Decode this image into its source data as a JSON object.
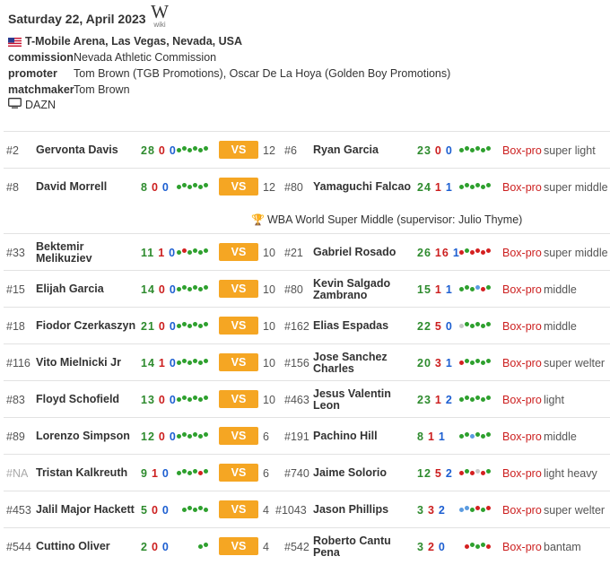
{
  "event": {
    "date": "Saturday 22, April 2023",
    "wiki_label": "wiki",
    "wiki_glyph": "W",
    "venue": "T-Mobile Arena, Las Vegas, Nevada, USA",
    "commission_label": "commission",
    "commission": "Nevada Athletic Commission",
    "promoter_label": "promoter",
    "promoter": "Tom Brown (TGB Promotions), Oscar De La Hoya (Golden Boy Promotions)",
    "matchmaker_label": "matchmaker",
    "matchmaker": "Tom Brown",
    "tv": "DAZN"
  },
  "vs_label": "VS",
  "boxpro_label": "Box-pro",
  "title_note": "WBA World Super Middle (supervisor: Julio Thyme)",
  "bouts": [
    {
      "r1": "#2",
      "n1": "Gervonta Davis",
      "w1": "28",
      "l1": "0",
      "d1": "0",
      "f1": "gggggg",
      "rounds": "12",
      "r2": "#6",
      "n2": "Ryan Garcia",
      "w2": "23",
      "l2": "0",
      "d2": "0",
      "f2": "gggggg",
      "division": "super light"
    },
    {
      "r1": "#8",
      "n1": "David Morrell",
      "w1": "8",
      "l1": "0",
      "d1": "0",
      "f1": "gggggg",
      "rounds": "12",
      "r2": "#80",
      "n2": "Yamaguchi Falcao",
      "w2": "24",
      "l2": "1",
      "d2": "1",
      "f2": "gggggg",
      "division": "super middle"
    },
    {
      "r1": "#33",
      "n1": "Bektemir Melikuziev",
      "w1": "11",
      "l1": "1",
      "d1": "0",
      "f1": "grgggg",
      "rounds": "10",
      "r2": "#21",
      "n2": "Gabriel Rosado",
      "w2": "26",
      "l2": "16",
      "d2": "1",
      "f2": "rgrrrr",
      "division": "super middle"
    },
    {
      "r1": "#15",
      "n1": "Elijah Garcia",
      "w1": "14",
      "l1": "0",
      "d1": "0",
      "f1": "gggggg",
      "rounds": "10",
      "r2": "#80",
      "n2": "Kevin Salgado Zambrano",
      "w2": "15",
      "l2": "1",
      "d2": "1",
      "f2": "gggbrg",
      "division": "middle"
    },
    {
      "r1": "#18",
      "n1": "Fiodor Czerkaszyn",
      "w1": "21",
      "l1": "0",
      "d1": "0",
      "f1": "gggggg",
      "rounds": "10",
      "r2": "#162",
      "n2": "Elias Espadas",
      "w2": "22",
      "l2": "5",
      "d2": "0",
      "f2": "xggggg",
      "division": "middle"
    },
    {
      "r1": "#116",
      "n1": "Vito Mielnicki Jr",
      "w1": "14",
      "l1": "1",
      "d1": "0",
      "f1": "gggggg",
      "rounds": "10",
      "r2": "#156",
      "n2": "Jose Sanchez Charles",
      "w2": "20",
      "l2": "3",
      "d2": "1",
      "f2": "rggggg",
      "division": "super welter"
    },
    {
      "r1": "#83",
      "n1": "Floyd Schofield",
      "w1": "13",
      "l1": "0",
      "d1": "0",
      "f1": "gggggg",
      "rounds": "10",
      "r2": "#463",
      "n2": "Jesus Valentin Leon",
      "w2": "23",
      "l2": "1",
      "d2": "2",
      "f2": "gggggg",
      "division": "light"
    },
    {
      "r1": "#89",
      "n1": "Lorenzo Simpson",
      "w1": "12",
      "l1": "0",
      "d1": "0",
      "f1": "gggggg",
      "rounds": "6",
      "r2": "#191",
      "n2": "Pachino Hill",
      "w2": "8",
      "l2": "1",
      "d2": "1",
      "f2": "ggbggg",
      "division": "middle"
    },
    {
      "r1": "#NA",
      "n1": "Tristan Kalkreuth",
      "w1": "9",
      "l1": "1",
      "d1": "0",
      "f1": "ggggrg",
      "rounds": "6",
      "r2": "#740",
      "n2": "Jaime Solorio",
      "w2": "12",
      "l2": "5",
      "d2": "2",
      "f2": "rgrxrg",
      "division": "light heavy"
    },
    {
      "r1": "#453",
      "n1": "Jalil Major Hackett",
      "w1": "5",
      "l1": "0",
      "d1": "0",
      "f1": "ggggg",
      "rounds": "4",
      "r2": "#1043",
      "n2": "Jason Phillips",
      "w2": "3",
      "l2": "3",
      "d2": "2",
      "f2": "bbgrgr",
      "division": "super welter"
    },
    {
      "r1": "#544",
      "n1": "Cuttino Oliver",
      "w1": "2",
      "l1": "0",
      "d1": "0",
      "f1": "gg",
      "rounds": "4",
      "r2": "#542",
      "n2": "Roberto Cantu Pena",
      "w2": "3",
      "l2": "2",
      "d2": "0",
      "f2": "rgggr",
      "division": "bantam"
    }
  ]
}
